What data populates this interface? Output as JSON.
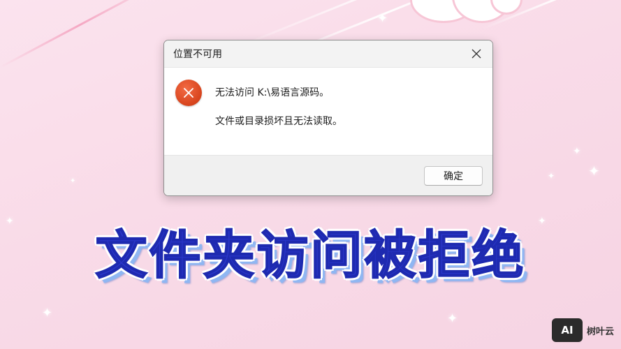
{
  "dialog": {
    "title": "位置不可用",
    "message_line1": "无法访问 K:\\易语言源码。",
    "message_line2": "文件或目录损坏且无法读取。",
    "ok_label": "确定",
    "icon": "error-icon",
    "close_icon": "close-icon"
  },
  "banner": {
    "headline": "文件夹访问被拒绝"
  },
  "watermark": {
    "logo_text": "AI",
    "brand": "树叶云"
  },
  "colors": {
    "background": "#f9dbe8",
    "headline_fill": "#2a36c8",
    "error_icon": "#d9461f"
  }
}
